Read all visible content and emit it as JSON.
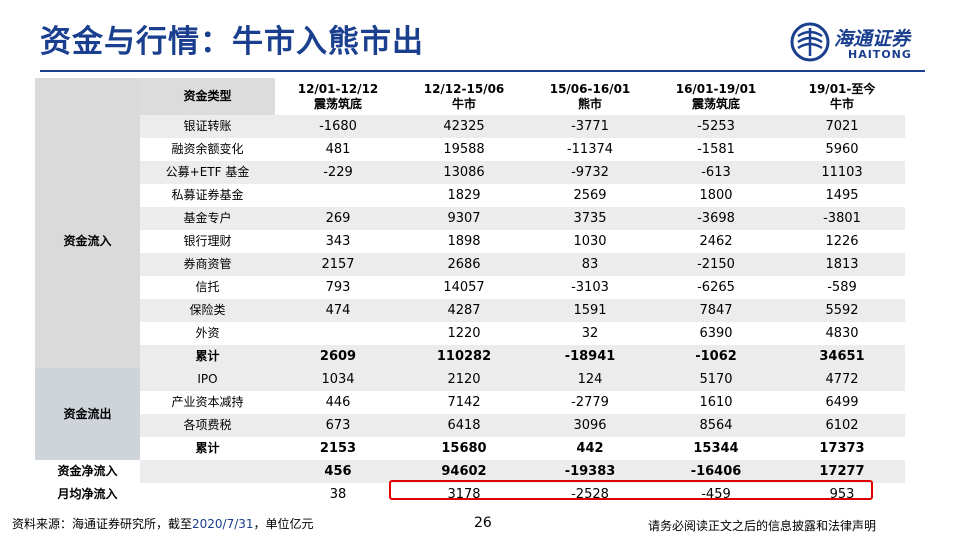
{
  "slide": {
    "title": "资金与行情：牛市入熊市出",
    "page_number": "26",
    "source": "资料来源：海通证券研究所，截至",
    "source_date": "2020/7/31",
    "source_unit": "，单位亿元",
    "disclaimer": "请务必阅读正文之后的信息披露和法律声明"
  },
  "logo": {
    "cn": "海通证券",
    "en": "HAITONG",
    "color": "#1a3f8f"
  },
  "table": {
    "type_header": "资金类型",
    "columns": [
      {
        "period": "12/01-12/12",
        "phase": "震荡筑底"
      },
      {
        "period": "12/12-15/06",
        "phase": "牛市"
      },
      {
        "period": "15/06-16/01",
        "phase": "熊市"
      },
      {
        "period": "16/01-19/01",
        "phase": "震荡筑底"
      },
      {
        "period": "19/01-至今",
        "phase": "牛市"
      }
    ],
    "groups": {
      "inflow": "资金流入",
      "outflow": "资金流出",
      "net": "资金净流入",
      "monthly": "月均净流入"
    },
    "inflow_rows": [
      {
        "label": "银证转账",
        "values": [
          "-1680",
          "42325",
          "-3771",
          "-5253",
          "7021"
        ]
      },
      {
        "label": "融资余额变化",
        "values": [
          "481",
          "19588",
          "-11374",
          "-1581",
          "5960"
        ]
      },
      {
        "label": "公募+ETF 基金",
        "values": [
          "-229",
          "13086",
          "-9732",
          "-613",
          "11103"
        ]
      },
      {
        "label": "私募证券基金",
        "values": [
          "",
          "1829",
          "2569",
          "1800",
          "1495"
        ]
      },
      {
        "label": "基金专户",
        "values": [
          "269",
          "9307",
          "3735",
          "-3698",
          "-3801"
        ]
      },
      {
        "label": "银行理财",
        "values": [
          "343",
          "1898",
          "1030",
          "2462",
          "1226"
        ]
      },
      {
        "label": "券商资管",
        "values": [
          "2157",
          "2686",
          "83",
          "-2150",
          "1813"
        ]
      },
      {
        "label": "信托",
        "values": [
          "793",
          "14057",
          "-3103",
          "-6265",
          "-589"
        ]
      },
      {
        "label": "保险类",
        "values": [
          "474",
          "4287",
          "1591",
          "7847",
          "5592"
        ]
      },
      {
        "label": "外资",
        "values": [
          "",
          "1220",
          "32",
          "6390",
          "4830"
        ]
      }
    ],
    "inflow_total": {
      "label": "累计",
      "values": [
        "2609",
        "110282",
        "-18941",
        "-1062",
        "34651"
      ]
    },
    "outflow_rows": [
      {
        "label": "IPO",
        "values": [
          "1034",
          "2120",
          "124",
          "5170",
          "4772"
        ]
      },
      {
        "label": "产业资本减持",
        "values": [
          "446",
          "7142",
          "-2779",
          "1610",
          "6499"
        ]
      },
      {
        "label": "各项费税",
        "values": [
          "673",
          "6418",
          "3096",
          "8564",
          "6102"
        ]
      }
    ],
    "outflow_total": {
      "label": "累计",
      "values": [
        "2153",
        "15680",
        "442",
        "15344",
        "17373"
      ]
    },
    "net_row": {
      "values": [
        "456",
        "94602",
        "-19383",
        "-16406",
        "17277"
      ]
    },
    "monthly_row": {
      "values": [
        "38",
        "3178",
        "-2528",
        "-459",
        "953"
      ]
    }
  },
  "colors": {
    "title_blue": "#1a3f8f",
    "highlight_red": "#e10000"
  }
}
